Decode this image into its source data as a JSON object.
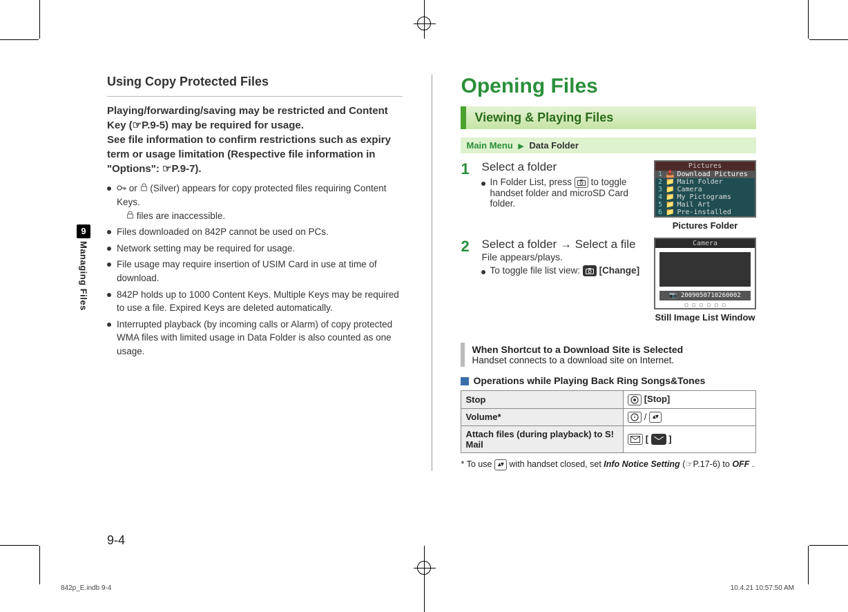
{
  "left": {
    "heading": "Using Copy Protected Files",
    "lead": "Playing/forwarding/saving may be restricted and Content Key (☞P.9-5) may be required for usage.\nSee file information to confirm restrictions such as expiry term or usage limitation (Respective file information in \"Options\": ☞P.9-7).",
    "bullet1_a": " or ",
    "bullet1_b": " (Silver) appears for copy protected files requiring Content Keys.",
    "bullet1_c": " files are inaccessible.",
    "bullet2": "Files downloaded on 842P cannot be used on PCs.",
    "bullet3": "Network setting may be required for usage.",
    "bullet4": "File usage may require insertion of USIM Card in use at time of download.",
    "bullet5": "842P holds up to 1000 Content Keys. Multiple Keys may be required to use a file. Expired Keys are deleted automatically.",
    "bullet6": "Interrupted playback (by incoming calls or Alarm) of copy protected WMA files with limited usage in Data Folder is also counted as one usage."
  },
  "right": {
    "heading": "Opening Files",
    "section": "Viewing & Playing Files",
    "mainmenu_label": "Main Menu",
    "mainmenu_path": "Data Folder",
    "step1_main": "Select a folder",
    "step1_sub_a": "In Folder List, press ",
    "step1_sub_b": " to toggle handset folder and microSD Card folder.",
    "screenshot1_title": "Pictures",
    "screenshot1_items": [
      "Download Pictures",
      "Main Folder",
      "Camera",
      "My Pictograms",
      "Mail Art",
      "Pre-installed"
    ],
    "screenshot1_caption": "Pictures Folder",
    "step2_main_a": "Select a folder ",
    "step2_main_b": " Select a file",
    "step2_line2": "File appears/plays.",
    "step2_sub_a": "To toggle file list view: ",
    "step2_sub_b": "[Change]",
    "screenshot2_title": "Camera",
    "screenshot2_filename": "2009050710260002",
    "screenshot2_caption": "Still Image List Window",
    "note_title": "When Shortcut to a Download Site is Selected",
    "note_body": "Handset connects to a download site on Internet.",
    "ops_heading": "Operations while Playing Back Ring Songs&Tones",
    "ops": [
      {
        "label": "Stop",
        "value": "[Stop]"
      },
      {
        "label": "Volume*",
        "value": "/"
      },
      {
        "label": "Attach files (during playback) to S! Mail",
        "value": "[ ✉ ]"
      }
    ],
    "footnote_a": "* To use ",
    "footnote_b": " with handset closed, set ",
    "footnote_c": "Info Notice Setting",
    "footnote_d": " (☞P.17-6) to ",
    "footnote_e": "OFF",
    "footnote_f": "."
  },
  "sidebar": {
    "chapter_no": "9",
    "chapter_name": "Managing Files"
  },
  "page_no": "9-4",
  "footer": {
    "left": "842p_E.indb   9-4",
    "right": "10.4.21   10:57:50 AM"
  }
}
